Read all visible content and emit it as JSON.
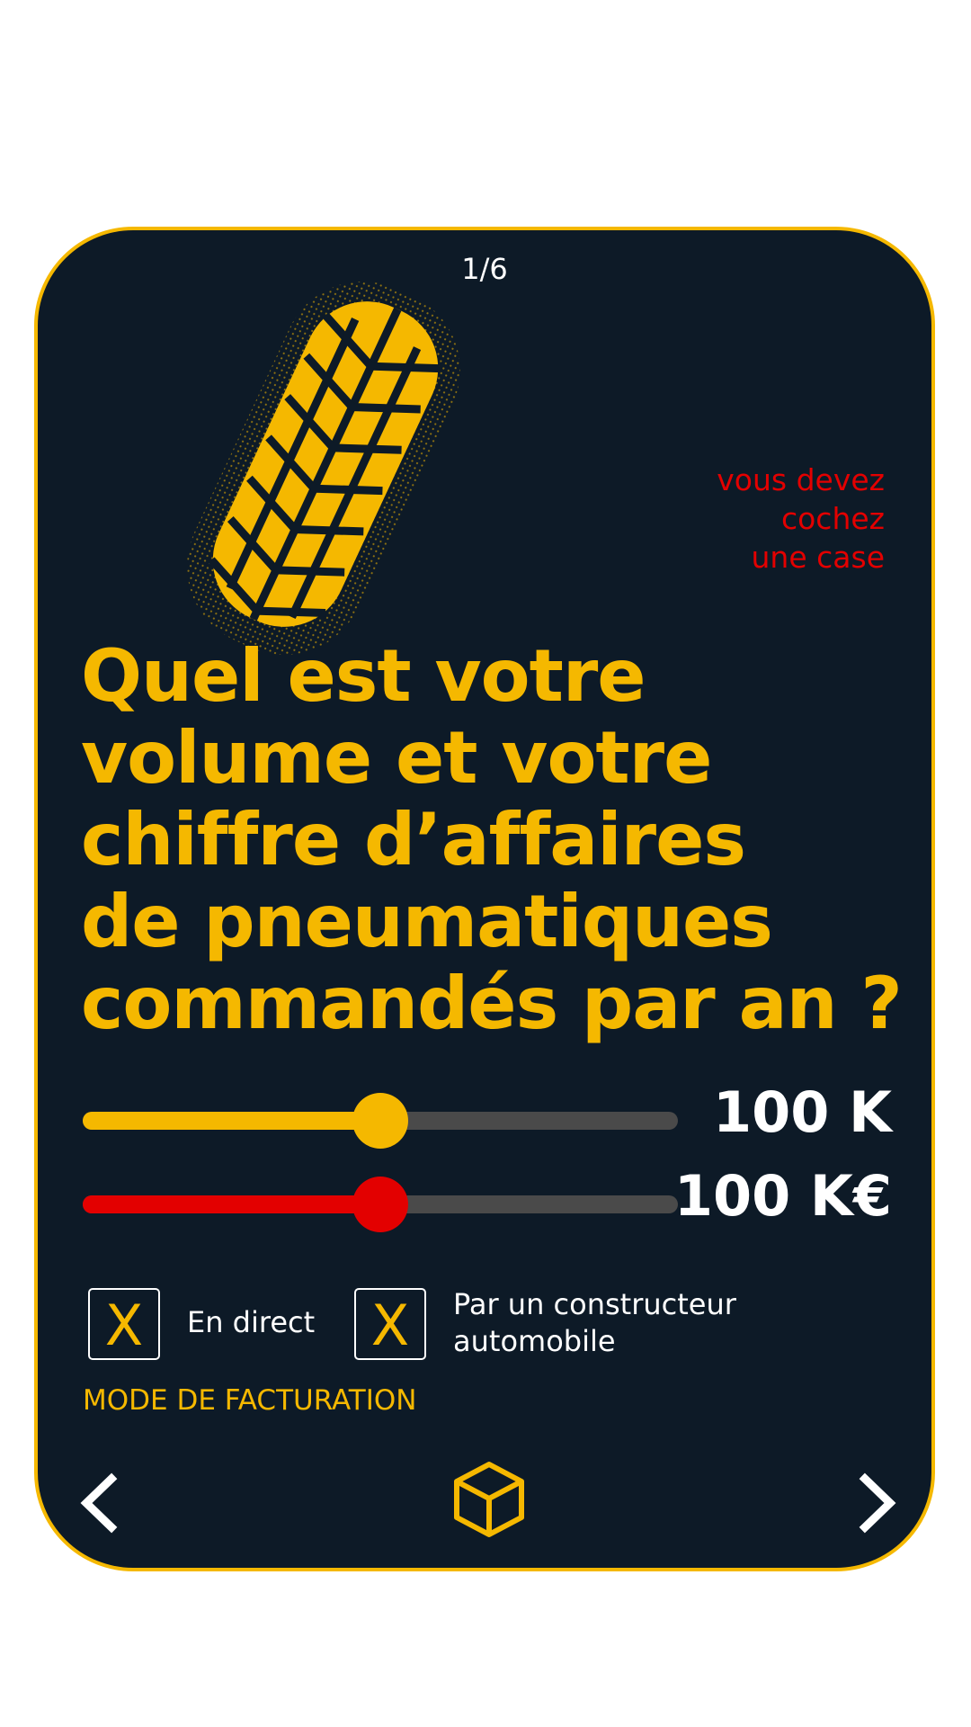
{
  "pager": "1/6",
  "hint_lines": [
    "vous devez",
    "cochez",
    "une case"
  ],
  "question": "Quel est votre\nvolume et votre\nchiffre d’affaires\nde pneumatiques\ncommandés par an ?",
  "sliders": [
    {
      "value_label": "100 K",
      "level": 0.5,
      "color": "#f5b800"
    },
    {
      "value_label": "100 K€",
      "level": 0.5,
      "color": "#e30000"
    }
  ],
  "options": [
    {
      "mark": "X",
      "label": "En direct"
    },
    {
      "mark": "X",
      "label": "Par un constructeur\nautomobile"
    }
  ],
  "section_label": "MODE DE FACTURATION",
  "nav": {
    "prev_icon": "chevron-left-icon",
    "center_icon": "box-icon",
    "next_icon": "chevron-right-icon"
  },
  "colors": {
    "accent": "#f5b800",
    "alert": "#e30000",
    "background": "#0d1a27"
  }
}
